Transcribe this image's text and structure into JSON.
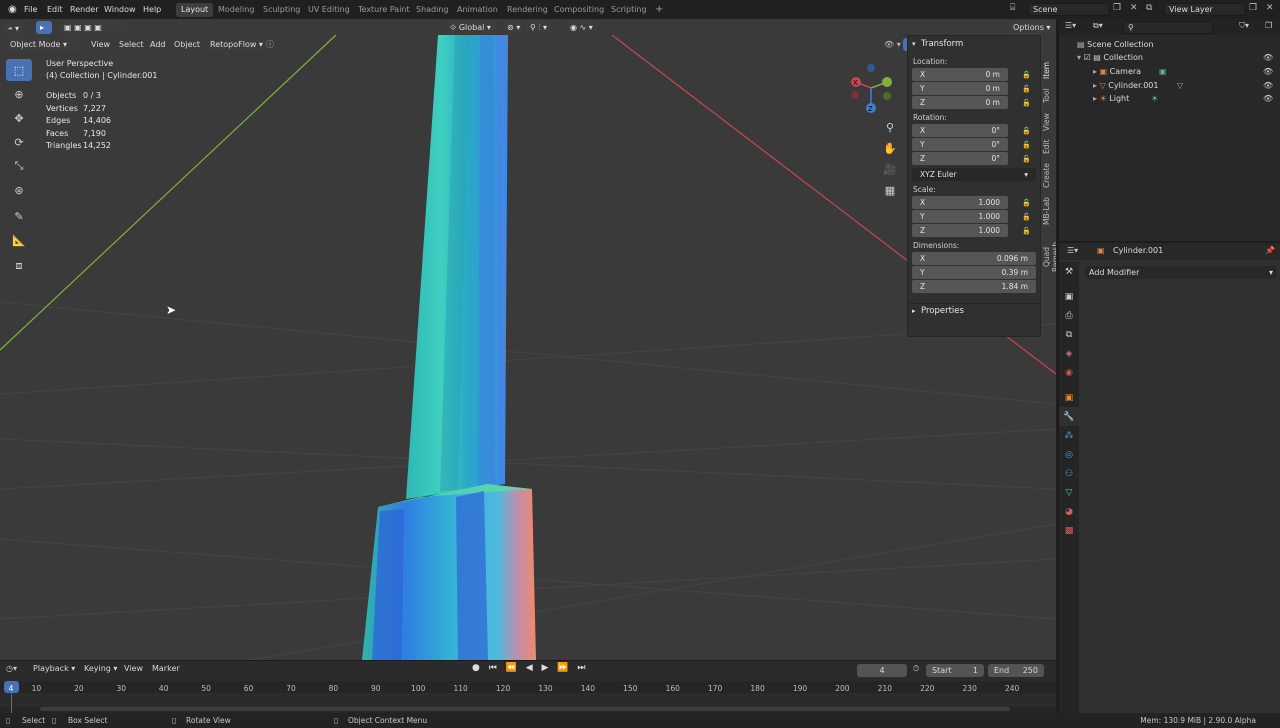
{
  "menu": {
    "items": [
      "File",
      "Edit",
      "Render",
      "Window",
      "Help"
    ]
  },
  "workspaces": [
    "Layout",
    "Modeling",
    "Sculpting",
    "UV Editing",
    "Texture Paint",
    "Shading",
    "Animation",
    "Rendering",
    "Compositing",
    "Scripting"
  ],
  "active_workspace": "Layout",
  "scene": {
    "name": "Scene",
    "view_layer": "View Layer"
  },
  "viewport_header": {
    "mode": "Object Mode",
    "menus": [
      "View",
      "Select",
      "Add",
      "Object"
    ],
    "addon": "RetopoFlow",
    "transform_orientation": "Global",
    "options": "Options"
  },
  "overlay": {
    "title": "User Perspective",
    "subtitle": "(4) Collection | Cylinder.001",
    "stats": [
      {
        "label": "Objects",
        "value": "0 / 3"
      },
      {
        "label": "Vertices",
        "value": "7,227"
      },
      {
        "label": "Edges",
        "value": "14,406"
      },
      {
        "label": "Faces",
        "value": "7,190"
      },
      {
        "label": "Triangles",
        "value": "14,252"
      }
    ]
  },
  "npanel": {
    "transform_title": "Transform",
    "location_label": "Location:",
    "location": [
      {
        "axis": "X",
        "value": "0 m"
      },
      {
        "axis": "Y",
        "value": "0 m"
      },
      {
        "axis": "Z",
        "value": "0 m"
      }
    ],
    "rotation_label": "Rotation:",
    "rotation": [
      {
        "axis": "X",
        "value": "0°"
      },
      {
        "axis": "Y",
        "value": "0°"
      },
      {
        "axis": "Z",
        "value": "0°"
      }
    ],
    "rotation_mode": "XYZ Euler",
    "scale_label": "Scale:",
    "scale": [
      {
        "axis": "X",
        "value": "1.000"
      },
      {
        "axis": "Y",
        "value": "1.000"
      },
      {
        "axis": "Z",
        "value": "1.000"
      }
    ],
    "dimensions_label": "Dimensions:",
    "dimensions": [
      {
        "axis": "X",
        "value": "0.096 m"
      },
      {
        "axis": "Y",
        "value": "0.39 m"
      },
      {
        "axis": "Z",
        "value": "1.84 m"
      }
    ],
    "properties_title": "Properties",
    "tabs": [
      "Item",
      "Tool",
      "View",
      "Edit",
      "Create",
      "MB-Lab",
      "Quad Remesh"
    ]
  },
  "outliner": {
    "root": "Scene Collection",
    "collection": "Collection",
    "items": [
      "Camera",
      "Cylinder.001",
      "Light"
    ]
  },
  "properties": {
    "object_name": "Cylinder.001",
    "add_modifier": "Add Modifier"
  },
  "timeline": {
    "menus": [
      "Playback",
      "Keying",
      "View",
      "Marker"
    ],
    "current_frame": "4",
    "start_label": "Start",
    "start": "1",
    "end_label": "End",
    "end": "250",
    "ticks": [
      "4",
      "10",
      "20",
      "30",
      "40",
      "50",
      "60",
      "70",
      "80",
      "90",
      "100",
      "110",
      "120",
      "130",
      "140",
      "150",
      "160",
      "170",
      "180",
      "190",
      "200",
      "210",
      "220",
      "230",
      "240"
    ]
  },
  "statusbar": {
    "select": "Select",
    "box_select": "Box Select",
    "rotate_view": "Rotate View",
    "context_menu": "Object Context Menu",
    "memory": "Mem: 130.9 MiB | 2.90.0 Alpha"
  },
  "colors": {
    "accent": "#4772b3",
    "x_axis": "#c9464f",
    "y_axis": "#7fb03a",
    "z_axis": "#3f7fd4"
  }
}
